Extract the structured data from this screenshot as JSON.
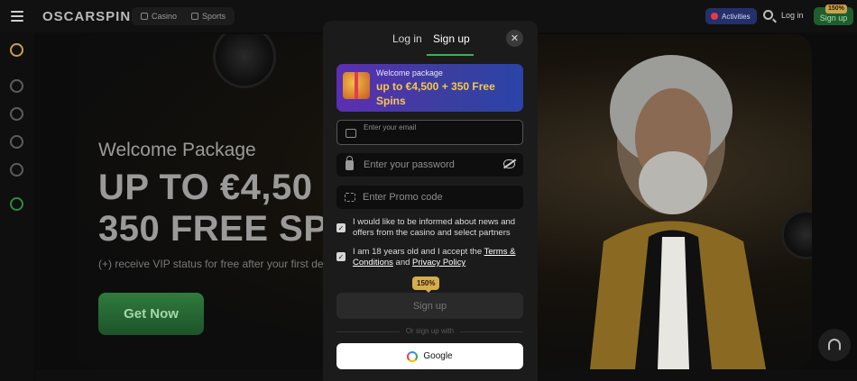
{
  "brand": {
    "logo_text": "OSCARSPIN"
  },
  "nav": {
    "casino": "Casino",
    "sports": "Sports"
  },
  "topbar": {
    "activities": "Activities",
    "login": "Log in",
    "signup": "Sign up",
    "signup_badge": "150%"
  },
  "hero": {
    "subtitle": "Welcome Package",
    "title_line1": "UP TO €4,50",
    "title_line2": "350 FREE SP",
    "note": "(+) receive VIP status for free after your first depo",
    "cta": "Get Now"
  },
  "modal": {
    "tab_login": "Log in",
    "tab_signup": "Sign up",
    "promo_label": "Welcome package",
    "promo_amount": "up to €4,500 + 350 Free Spins",
    "email_placeholder": "Enter your email",
    "password_placeholder": "Enter your password",
    "promo_placeholder": "Enter Promo code",
    "consent_news": "I would like to be informed about news and offers from the casino and select partners",
    "consent_age_prefix": "I am 18 years old and I accept the ",
    "terms_link": "Terms & Conditions",
    "consent_and": " and ",
    "privacy_link": "Privacy Policy",
    "badge": "150%",
    "signup_button": "Sign up",
    "or_text": "Or sign up with",
    "google": "Google"
  },
  "colors": {
    "accent_green": "#36b44f",
    "promo_gold": "#f6c94a",
    "badge_gold": "#d6ad4e",
    "activities_bg": "#24306a"
  },
  "icons": [
    "hamburger-icon",
    "casino-icon",
    "sports-icon",
    "search-icon",
    "gift-icon",
    "mail-icon",
    "lock-icon",
    "eye-off-icon",
    "promo-code-icon",
    "check-icon",
    "google-icon",
    "close-icon",
    "headset-icon"
  ]
}
